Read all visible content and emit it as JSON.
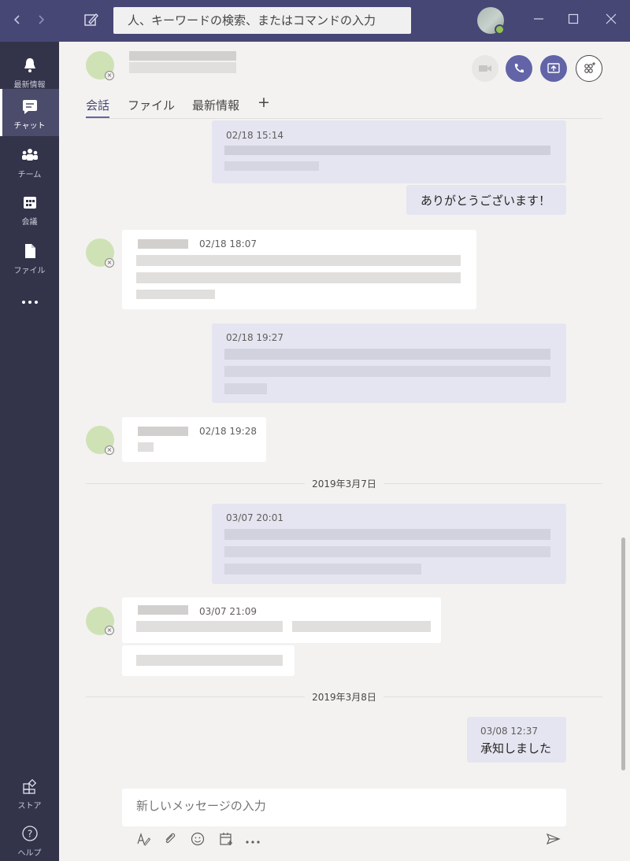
{
  "titlebar": {
    "back_icon": "chevron-left-icon",
    "forward_icon": "chevron-right-icon",
    "compose_icon": "compose-icon",
    "search_placeholder": "人、キーワードの検索、またはコマンドの入力",
    "window_buttons": [
      "minimize-icon",
      "maximize-icon",
      "close-icon"
    ]
  },
  "rail": {
    "items": [
      {
        "label": "最新情報",
        "icon": "bell-icon"
      },
      {
        "label": "チャット",
        "icon": "chat-icon",
        "active": true
      },
      {
        "label": "チーム",
        "icon": "teams-icon"
      },
      {
        "label": "会議",
        "icon": "calendar-icon"
      },
      {
        "label": "ファイル",
        "icon": "file-icon"
      },
      {
        "label": "",
        "icon": "more-icon"
      }
    ],
    "bottom": [
      {
        "label": "ストア",
        "icon": "store-icon"
      },
      {
        "label": "ヘルプ",
        "icon": "help-icon"
      }
    ]
  },
  "header": {
    "tabs": [
      "会話",
      "ファイル",
      "最新情報"
    ],
    "add_tab": "+",
    "actions": [
      "video-call-icon",
      "audio-call-icon",
      "share-screen-icon",
      "add-people-icon"
    ]
  },
  "messages": [
    {
      "who": "me",
      "time": "02/18 15:14"
    },
    {
      "who": "me",
      "text": "ありがとうございます！"
    },
    {
      "who": "them",
      "time": "02/18 18:07"
    },
    {
      "who": "me",
      "time": "02/18 19:27"
    },
    {
      "who": "them",
      "time": "02/18 19:28"
    },
    {
      "who": "divider",
      "label": "2019年3月7日"
    },
    {
      "who": "me",
      "time": "03/07 20:01"
    },
    {
      "who": "them",
      "time": "03/07 21:09"
    },
    {
      "who": "divider",
      "label": "2019年3月8日"
    },
    {
      "who": "me",
      "time": "03/08 12:37",
      "text": "承知しました"
    }
  ],
  "compose": {
    "placeholder": "新しいメッセージの入力",
    "tools": [
      "format-icon",
      "attach-icon",
      "emoji-icon",
      "schedule-icon",
      "more-icon"
    ],
    "send_icon": "send-icon"
  },
  "colors": {
    "titlebar": "#464775",
    "rail": "#33344a",
    "accent": "#6264a7",
    "my_bubble": "#e5e5f1",
    "their_bubble": "#ffffff"
  }
}
